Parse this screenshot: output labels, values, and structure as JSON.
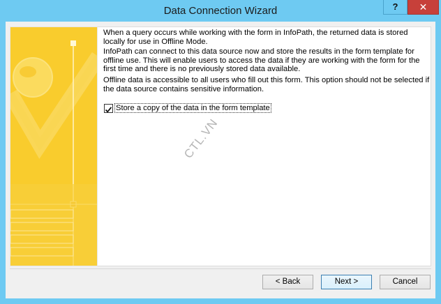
{
  "window": {
    "title": "Data Connection Wizard",
    "help_label": "?",
    "close_label": "✕"
  },
  "content": {
    "paragraph1": "When a query occurs while working with the form in InfoPath, the returned data is stored locally for use in Offline Mode.",
    "paragraph2": "InfoPath can connect to this data source now and store the results in the form template for offline use. This will enable users to access the data if they are working with the form for the first time and there is no previously stored data available.",
    "paragraph3": "Offline data is accessible to all users who fill out this form. This option should not be selected if the data source contains sensitive information.",
    "checkbox_label": "Store a copy of the data in the form template",
    "checkbox_checked": true,
    "watermark": "CTL.VN"
  },
  "buttons": {
    "back": "< Back",
    "next": "Next >",
    "cancel": "Cancel"
  },
  "colors": {
    "frame": "#6ecaf2",
    "close": "#c7403a",
    "banner": "#f7c524"
  }
}
